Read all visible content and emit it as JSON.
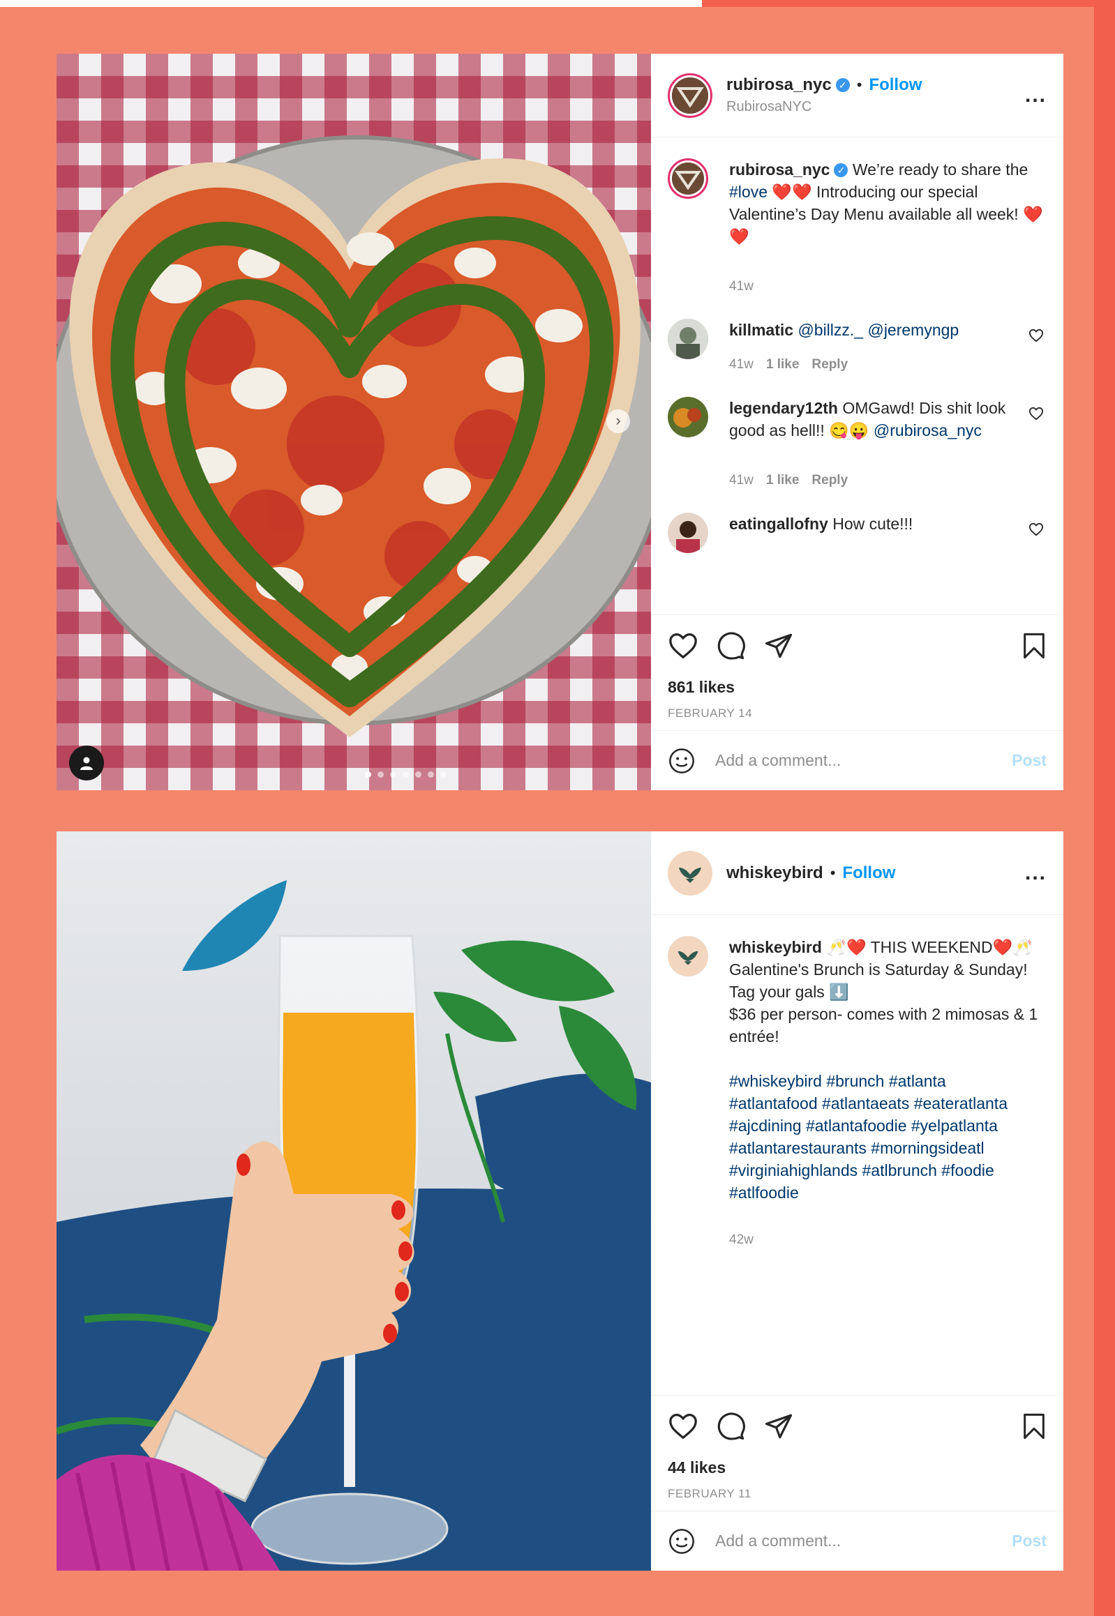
{
  "post1": {
    "header": {
      "username": "rubirosa_nyc",
      "verified": true,
      "follow": "Follow",
      "subtitle": "RubirosaNYC",
      "more": "..."
    },
    "caption": {
      "username": "rubirosa_nyc",
      "text_a": "We’re ready to share the ",
      "hashtag": "#love",
      "text_b": " ❤️❤️ Introducing our special Valentine’s Day Menu available all week! ❤️❤️",
      "time": "41w"
    },
    "comments": [
      {
        "username": "killmatic",
        "text": "",
        "mention": "@billzz._ @jeremyngp",
        "time": "41w",
        "likes": "1 like",
        "reply": "Reply"
      },
      {
        "username": "legendary12th",
        "text": "OMGawd! Dis shit look good as hell!! 😋😛 ",
        "mention": "@rubirosa_nyc",
        "time": "41w",
        "likes": "1 like",
        "reply": "Reply"
      },
      {
        "username": "eatingallofny",
        "text": "How cute!!!",
        "mention": ""
      }
    ],
    "likes": "861 likes",
    "date": "FEBRUARY 14",
    "add_comment_placeholder": "Add a comment...",
    "post_button": "Post",
    "carousel_count": 7,
    "carousel_active": 0
  },
  "post2": {
    "header": {
      "username": "whiskeybird",
      "follow": "Follow",
      "more": "..."
    },
    "caption": {
      "username": "whiskeybird",
      "text": "🥂❤️ THIS WEEKEND❤️🥂\nGalentine's Brunch is Saturday & Sunday! Tag your gals ⬇️\n$36 per person- comes with 2 mimosas & 1 entrée!",
      "hashtags": "#whiskeybird #brunch #atlanta\n#atlantafood #atlantaeats #eateratlanta\n#ajcdining #atlantafoodie #yelpatlanta\n#atlantarestaurants #morningsideatl\n#virginiahighlands #atlbrunch #foodie\n#atlfoodie",
      "time": "42w"
    },
    "likes": "44 likes",
    "date": "FEBRUARY 11",
    "add_comment_placeholder": "Add a comment...",
    "post_button": "Post"
  },
  "colors": {
    "page_bg": "#f4866c",
    "follow": "#0095f6",
    "hashtag": "#00376b",
    "post_disabled": "#b2dffc"
  }
}
